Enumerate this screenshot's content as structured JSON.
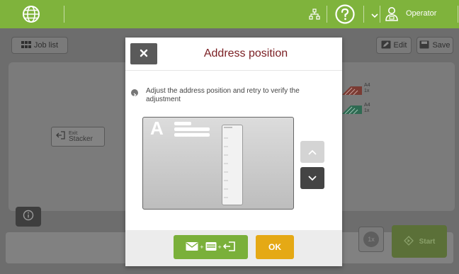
{
  "topbar": {
    "user_label": "Operator",
    "accent_color": "#7fb33c",
    "icons": [
      "globe-icon",
      "network-icon",
      "help-icon",
      "chevron-down-icon",
      "user-icon"
    ]
  },
  "toolbar": {
    "job_list_label": "Job list",
    "edit_label": "Edit",
    "save_label": "Save"
  },
  "canvas": {
    "exit_small": "Exit:",
    "exit_big": "Stacker",
    "doc1_size": "A4",
    "doc1_count": "1x",
    "doc2_size": "A4",
    "doc2_count": "1x"
  },
  "footer": {
    "count_label": "1x",
    "start_label": "Start"
  },
  "modal": {
    "title": "Address position",
    "instruction": "Adjust the address position and retry to verify the adjustment",
    "envelope_letter": "A",
    "ok_label": "OK",
    "title_color": "#7a1e22",
    "ok_color": "#e5a915",
    "combo_color": "#7ab03a"
  }
}
